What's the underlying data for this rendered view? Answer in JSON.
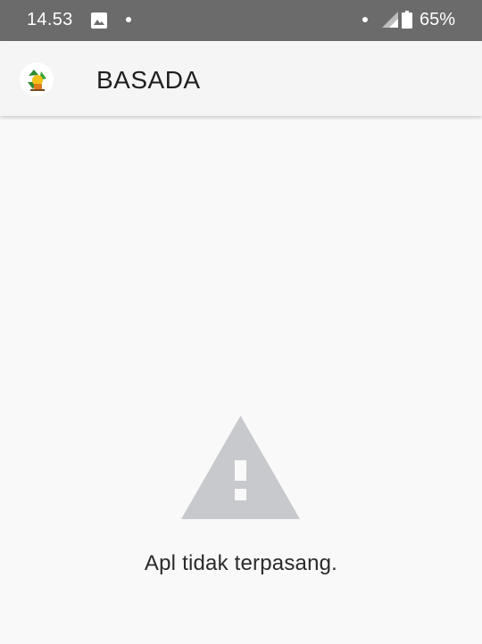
{
  "status_bar": {
    "time": "14.53",
    "battery_percent": "65%",
    "icons": [
      "image-icon",
      "notification-dot-icon",
      "notification-dot-icon",
      "cell-signal-icon",
      "battery-icon"
    ]
  },
  "app_bar": {
    "title": "BASADA",
    "logo_icon": "recycle-logo-icon"
  },
  "content": {
    "warning_icon": "warning-triangle-icon",
    "message": "Apl tidak terpasang."
  },
  "colors": {
    "status_bar_bg": "#6b6b6b",
    "app_bar_bg": "#f5f5f5",
    "content_bg": "#f9f9f9",
    "warning_icon": "#c7c9cc"
  }
}
